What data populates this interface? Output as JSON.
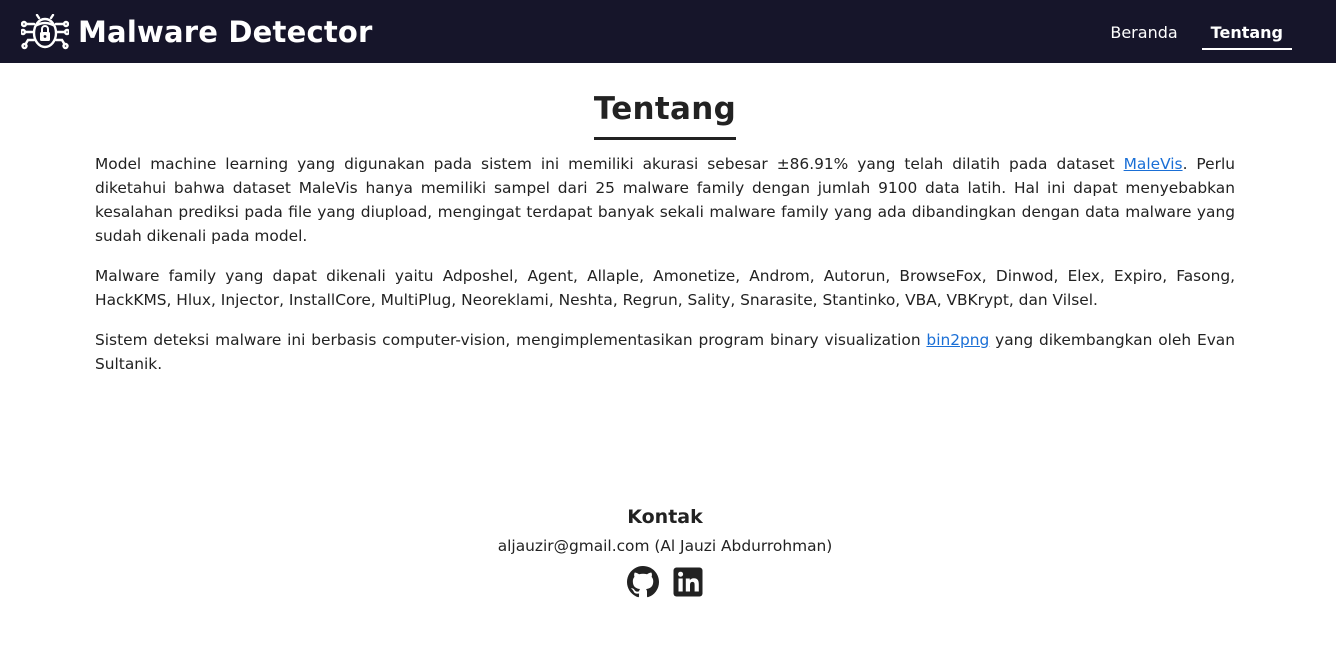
{
  "navbar": {
    "brand_icon": "bug-circuit-icon",
    "brand_title": "Malware Detector",
    "links": [
      {
        "label": "Beranda",
        "active": false
      },
      {
        "label": "Tentang",
        "active": true
      }
    ],
    "background": "#16152a"
  },
  "main": {
    "title": "Tentang",
    "p1_before": "Model machine learning yang digunakan pada sistem ini memiliki akurasi sebesar ±86.91% yang telah dilatih pada dataset ",
    "p1_link": "MaleVis",
    "p1_after": ". Perlu diketahui bahwa dataset MaleVis hanya memiliki sampel dari 25 malware family dengan jumlah 9100 data latih. Hal ini dapat menyebabkan kesalahan prediksi pada file yang diupload, mengingat terdapat banyak sekali malware family yang ada dibandingkan dengan data malware yang sudah dikenali pada model.",
    "p2": "Malware family yang dapat dikenali yaitu Adposhel, Agent, Allaple, Amonetize, Androm, Autorun, BrowseFox, Dinwod, Elex, Expiro, Fasong, HackKMS, Hlux, Injector, InstallCore, MultiPlug, Neoreklami, Neshta, Regrun, Sality, Snarasite, Stantinko, VBA, VBKrypt, dan Vilsel.",
    "p3_before": "Sistem deteksi malware ini berbasis computer-vision, mengimplementasikan program binary visualization ",
    "p3_link": "bin2png",
    "p3_after": " yang dikembangkan oleh Evan Sultanik.",
    "link_color": "#1a6fd6"
  },
  "footer": {
    "title": "Kontak",
    "email": "aljauzir@gmail.com (Al Jauzi Abdurrohman)",
    "socials": [
      "github-icon",
      "linkedin-icon"
    ]
  }
}
